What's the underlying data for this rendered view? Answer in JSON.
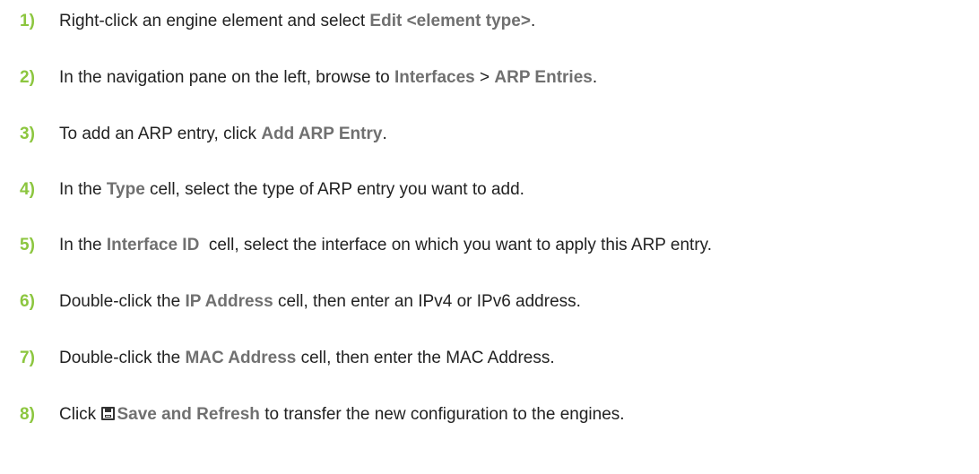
{
  "steps": [
    {
      "number": "1)",
      "parts": [
        "Right-click an engine element and select ",
        "Edit <element type>",
        "."
      ]
    },
    {
      "number": "2)",
      "parts": [
        "In the navigation pane on the left, browse to ",
        "Interfaces",
        " > ",
        "ARP Entries",
        "."
      ]
    },
    {
      "number": "3)",
      "parts": [
        "To add an ARP entry, click ",
        "Add ARP Entry",
        "."
      ]
    },
    {
      "number": "4)",
      "parts": [
        "In the ",
        "Type",
        " cell, select the type of ARP entry you want to add."
      ]
    },
    {
      "number": "5)",
      "parts": [
        "In the ",
        "Interface ID",
        "  cell, select the interface on which you want to apply this ARP entry."
      ]
    },
    {
      "number": "6)",
      "parts": [
        "Double-click the ",
        "IP Address",
        " cell, then enter an IPv4 or IPv6 address."
      ]
    },
    {
      "number": "7)",
      "parts": [
        "Double-click the ",
        "MAC Address",
        " cell, then enter the MAC Address."
      ]
    },
    {
      "number": "8)",
      "parts": [
        "Click ",
        "Save and Refresh",
        " to transfer the new configuration to the engines."
      ],
      "icon": "save-icon"
    }
  ],
  "colors": {
    "step_number": "#8cc63f",
    "ui_term": "#707070",
    "body_text": "#222222"
  }
}
